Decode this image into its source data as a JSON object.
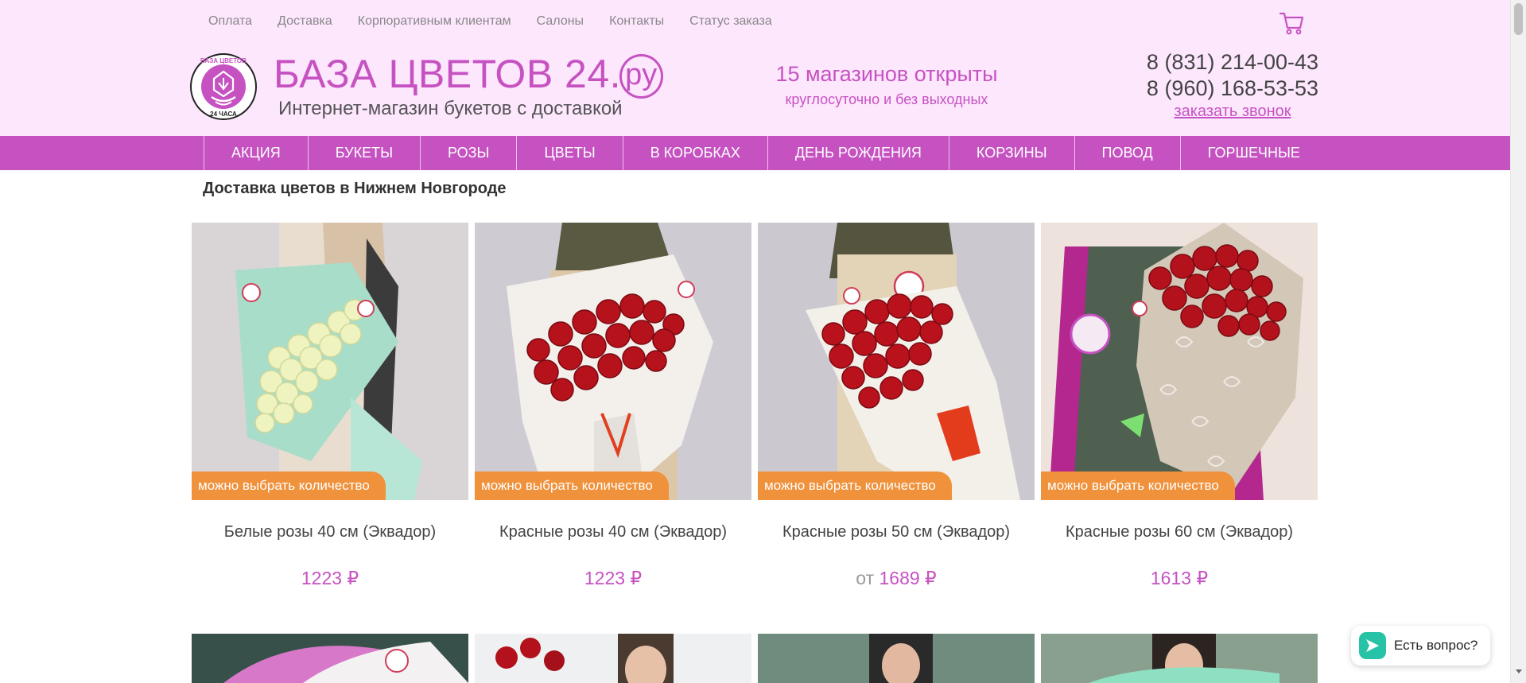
{
  "topnav": {
    "items": [
      "Оплата",
      "Доставка",
      "Корпоративным клиентам",
      "Салоны",
      "Контакты",
      "Статус заказа"
    ]
  },
  "header": {
    "logo_text_top": "БАЗА ЦВЕТОВ",
    "logo_text_bottom": "24 ЧАСА",
    "brand_name": "БАЗА ЦВЕТОВ 24.",
    "brand_domain": "ру",
    "tagline": "Интернет-магазин букетов с доставкой",
    "stores_line1": "15 магазинов открыты",
    "stores_line2": "круглосуточно и без выходных",
    "phone1": "8 (831) 214-00-43",
    "phone2": "8 (960) 168-53-53",
    "callback_label": "заказать звонок"
  },
  "menu": {
    "items": [
      "АКЦИЯ",
      "БУКЕТЫ",
      "РОЗЫ",
      "ЦВЕТЫ",
      "В КОРОБКАХ",
      "ДЕНЬ РОЖДЕНИЯ",
      "КОРЗИНЫ",
      "ПОВОД",
      "ГОРШЕЧНЫЕ"
    ]
  },
  "page": {
    "title": "Доставка цветов в Нижнем Новгороде"
  },
  "products": [
    {
      "badge": "можно выбрать количество",
      "title": "Белые розы 40 см (Эквадор)",
      "price_prefix": "",
      "price": "1223 ₽"
    },
    {
      "badge": "можно выбрать количество",
      "title": "Красные розы 40 см (Эквадор)",
      "price_prefix": "",
      "price": "1223 ₽"
    },
    {
      "badge": "можно выбрать количество",
      "title": "Красные розы 50 см (Эквадор)",
      "price_prefix": "от",
      "price": "1689 ₽"
    },
    {
      "badge": "можно выбрать количество",
      "title": "Красные розы 60 см (Эквадор)",
      "price_prefix": "",
      "price": "1613 ₽"
    }
  ],
  "chat": {
    "label": "Есть вопрос?"
  },
  "colors": {
    "brand": "#c652c2",
    "header_bg": "#fde7fd",
    "badge": "#f0913b"
  },
  "icons": {
    "cart": "cart-icon",
    "chat": "chat-icon"
  }
}
